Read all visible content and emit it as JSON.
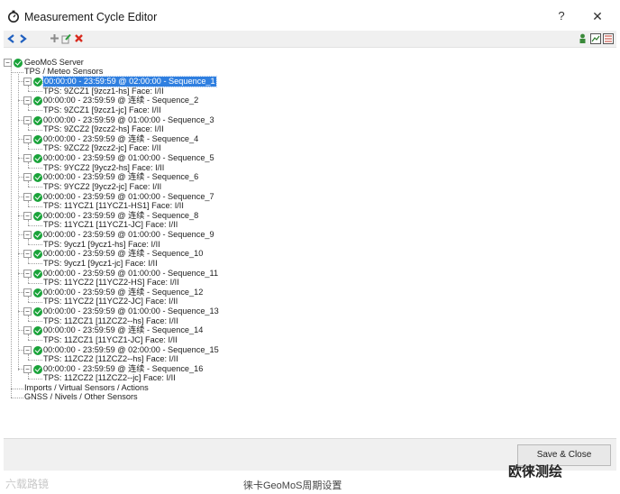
{
  "window": {
    "title": "Measurement Cycle Editor",
    "help_label": "?",
    "close_label": "✕"
  },
  "toolbar": {
    "icons": [
      "back-arrow",
      "forward-arrow",
      "add-icon",
      "edit-icon",
      "delete-icon",
      "sensor-icon",
      "chart-icon",
      "settings-icon"
    ]
  },
  "tree": {
    "root": "GeoMoS Server",
    "group_tps": "TPS / Meteo Sensors",
    "sequences": [
      {
        "label": "00:00:00 - 23:59:59 @ 02:00:00 - Sequence_1",
        "child": "TPS: 9ZCZ1 [9zcz1-hs] Face: I/II"
      },
      {
        "label": "00:00:00 - 23:59:59 @ 连续 - Sequence_2",
        "child": "TPS: 9ZCZ1 [9zcz1-jc] Face: I/II"
      },
      {
        "label": "00:00:00 - 23:59:59 @ 01:00:00 - Sequence_3",
        "child": "TPS: 9ZCZ2 [9zcz2-hs] Face: I/II"
      },
      {
        "label": "00:00:00 - 23:59:59 @ 连续 - Sequence_4",
        "child": "TPS: 9ZCZ2 [9zcz2-jc] Face: I/II"
      },
      {
        "label": "00:00:00 - 23:59:59 @ 01:00:00 - Sequence_5",
        "child": "TPS: 9YCZ2 [9ycz2-hs] Face: I/II"
      },
      {
        "label": "00:00:00 - 23:59:59 @ 连续 - Sequence_6",
        "child": "TPS: 9YCZ2 [9ycz2-jc] Face: I/II"
      },
      {
        "label": "00:00:00 - 23:59:59 @ 01:00:00 - Sequence_7",
        "child": "TPS: 11YCZ1 [11YCZ1-HS1] Face: I/II"
      },
      {
        "label": "00:00:00 - 23:59:59 @ 连续 - Sequence_8",
        "child": "TPS: 11YCZ1 [11YCZ1-JC] Face: I/II"
      },
      {
        "label": "00:00:00 - 23:59:59 @ 01:00:00 - Sequence_9",
        "child": "TPS: 9ycz1 [9ycz1-hs] Face: I/II"
      },
      {
        "label": "00:00:00 - 23:59:59 @ 连续 - Sequence_10",
        "child": "TPS: 9ycz1 [9ycz1-jc] Face: I/II"
      },
      {
        "label": "00:00:00 - 23:59:59 @ 01:00:00 - Sequence_11",
        "child": "TPS: 11YCZ2 [11YCZ2-HS] Face: I/II"
      },
      {
        "label": "00:00:00 - 23:59:59 @ 连续 - Sequence_12",
        "child": "TPS: 11YCZ2 [11YCZ2-JC] Face: I/II"
      },
      {
        "label": "00:00:00 - 23:59:59 @ 01:00:00 - Sequence_13",
        "child": "TPS: 11ZCZ1 [11ZCZ2--hs] Face: I/II"
      },
      {
        "label": "00:00:00 - 23:59:59 @ 连续 - Sequence_14",
        "child": "TPS: 11ZCZ1 [11YCZ1-JC] Face: I/II"
      },
      {
        "label": "00:00:00 - 23:59:59 @ 02:00:00 - Sequence_15",
        "child": "TPS: 11ZCZ2 [11ZCZ2--hs] Face: I/II"
      },
      {
        "label": "00:00:00 - 23:59:59 @ 连续 - Sequence_16",
        "child": "TPS: 11ZCZ2 [11ZCZ2--jc] Face: I/II"
      }
    ],
    "selected_index": 0,
    "group_imports": "Imports / Virtual Sensors / Actions",
    "group_gnss": "GNSS / Nivels / Other Sensors"
  },
  "footer": {
    "save_close_label": "Save & Close"
  },
  "caption": {
    "text": "徕卡GeoMoS周期设置",
    "watermark_left": "六载路镜",
    "watermark_right": "欧徕测绘"
  },
  "colors": {
    "selection": "#2f7fe0",
    "check": "#1aa33a",
    "toolbar_bg": "#f0f0f0"
  }
}
